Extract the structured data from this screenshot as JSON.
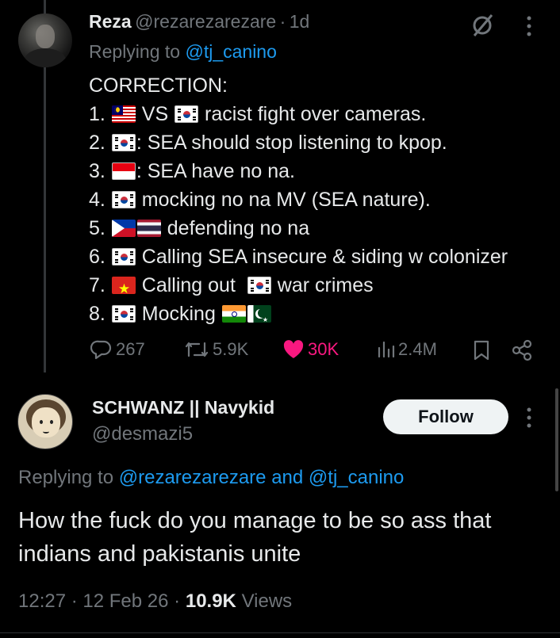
{
  "tweet1": {
    "display_name": "Reza",
    "handle": "@rezarezarezare",
    "sep": "·",
    "time_ago": "1d",
    "replying_prefix": "Replying to",
    "replying_to": "@tj_canino",
    "lines": {
      "title": "CORRECTION:",
      "l1_num": "1.",
      "l1_a": "VS",
      "l1_b": "racist fight over cameras.",
      "l2_num": "2.",
      "l2_a": ": SEA should stop listening to kpop.",
      "l3_num": "3.",
      "l3_a": ": SEA have no na.",
      "l4_num": "4.",
      "l4_a": "mocking no na MV (SEA nature).",
      "l5_num": "5.",
      "l5_a": "defending no na",
      "l6_num": "6.",
      "l6_a": "Calling SEA insecure & siding w colonizer",
      "l7_num": "7.",
      "l7_a": "Calling out",
      "l7_b": "war crimes",
      "l8_num": "8.",
      "l8_a": "Mocking"
    },
    "flags": [
      "malaysia",
      "south-korea",
      "indonesia",
      "philippines",
      "thailand",
      "vietnam",
      "india",
      "pakistan"
    ],
    "actions": {
      "replies": "267",
      "reposts": "5.9K",
      "likes": "30K",
      "views": "2.4M"
    }
  },
  "tweet2": {
    "display_name": "SCHWANZ || Navykid",
    "handle": "@desmazi5",
    "follow_label": "Follow",
    "replying_prefix": "Replying to",
    "replying_to_1": "@rezarezarezare",
    "replying_and": "and",
    "replying_to_2": "@tj_canino",
    "text": "How the fuck do you manage to be so ass that indians and pakistanis unite",
    "time": "12:27",
    "sep1": "·",
    "date": "12 Feb 26",
    "sep2": "·",
    "views_count": "10.9K",
    "views_label": "Views"
  },
  "colors": {
    "background": "#000000",
    "text": "#e7e9ea",
    "muted": "#71767b",
    "link": "#1d9bf0",
    "like": "#f91880"
  }
}
